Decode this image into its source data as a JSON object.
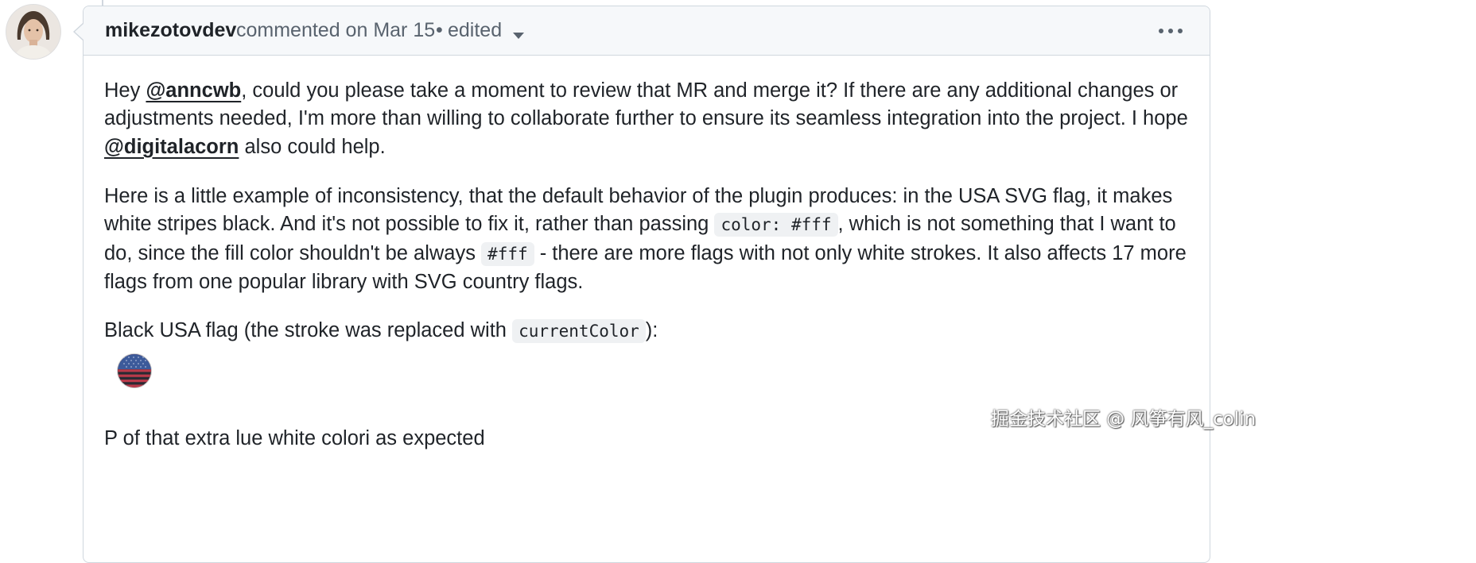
{
  "comment": {
    "author": "mikezotovdev",
    "meta": "commented on Mar 15",
    "separator": "•",
    "edited_label": "edited",
    "paragraph1": {
      "t1": "Hey ",
      "mention1": "@anncwb",
      "t2": ", could you please take a moment to review that MR and merge it? If there are any additional changes or adjustments needed, I'm more than willing to collaborate further to ensure its seamless integration into the project. I hope ",
      "mention2": "@digitalacorn",
      "t3": " also could help."
    },
    "paragraph2": {
      "t1": "Here is a little example of inconsistency, that the default behavior of the plugin produces: in the USA SVG flag, it makes white stripes black. And it's not possible to fix it, rather than passing ",
      "code1": "color: #fff",
      "t2": ", which is not something that I want to do, since the fill color shouldn't be always ",
      "code2": "#fff",
      "t3": " - there are more flags with not only white strokes. It also affects 17 more flags from one popular library with SVG country flags."
    },
    "paragraph3": {
      "t1": "Black USA flag (the stroke was replaced with ",
      "code1": "currentColor",
      "t2": "):"
    },
    "paragraph4_clipped": "P  of that extra lue white colori    as expected"
  },
  "watermark": "掘金技术社区 @ 风筝有风_colin",
  "icons": {
    "caret": "triangle-down-icon",
    "kebab": "kebab-horizontal-icon",
    "flag": "usa-flag-image"
  },
  "colors": {
    "header_bg": "#f6f8fa",
    "border": "#d0d7de",
    "muted_text": "#59636e",
    "text": "#1f2328",
    "code_bg": "#eff1f3"
  }
}
